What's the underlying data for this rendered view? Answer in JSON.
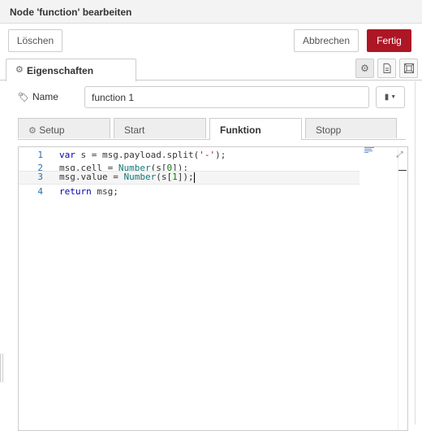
{
  "dialog": {
    "title": "Node 'function' bearbeiten"
  },
  "toolbar": {
    "delete_label": "Löschen",
    "cancel_label": "Abbrechen",
    "done_label": "Fertig"
  },
  "tabs": {
    "properties_label": "Eigenschaften"
  },
  "name_field": {
    "label": "Name",
    "value": "function 1"
  },
  "subtabs": [
    {
      "label": "Setup",
      "icon": "gear-icon"
    },
    {
      "label": "Start"
    },
    {
      "label": "Funktion",
      "active": true
    },
    {
      "label": "Stopp"
    }
  ],
  "editor": {
    "lines": [
      {
        "number": "1",
        "code": "var s = msg.payload.split('-');"
      },
      {
        "number": "2",
        "code": "msg.cell = Number(s[0]);"
      },
      {
        "number": "3",
        "code": "msg.value = Number(s[1]);"
      },
      {
        "number": "4",
        "code": "return msg;"
      }
    ]
  },
  "colors": {
    "primary": "#ad1625",
    "border": "#cccccc",
    "line_number": "#2b6fa8"
  }
}
